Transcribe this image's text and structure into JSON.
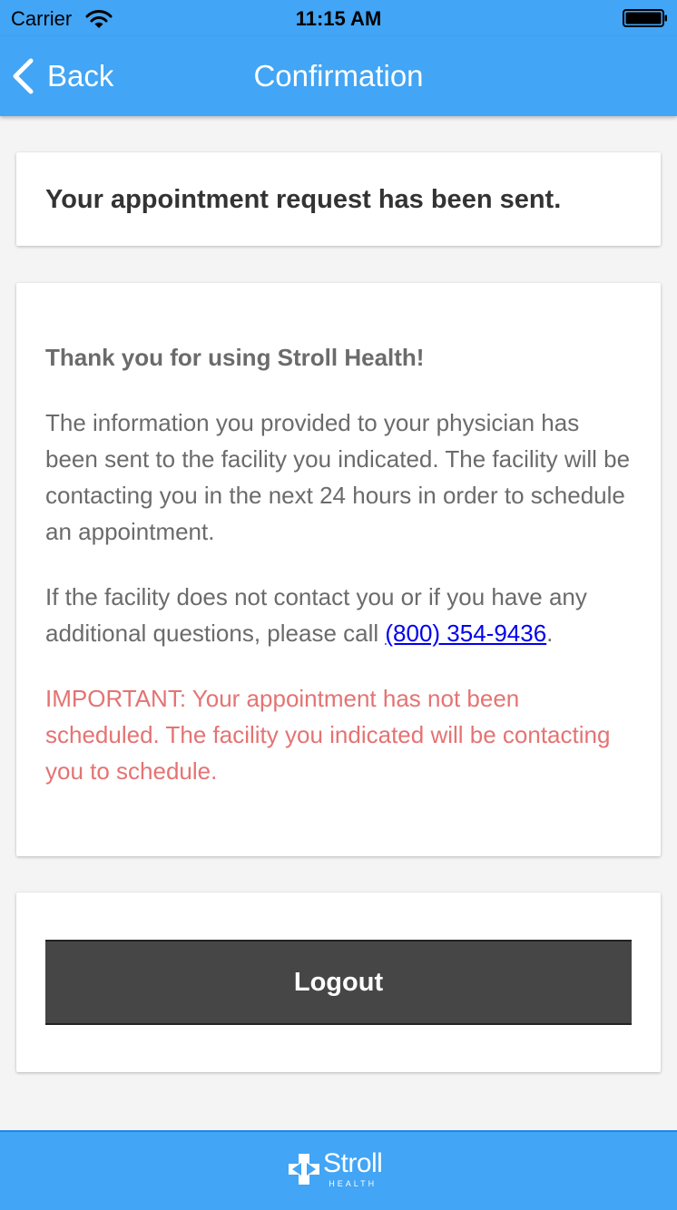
{
  "status_bar": {
    "carrier": "Carrier",
    "time": "11:15 AM",
    "wifi_icon": "wifi-icon",
    "battery_icon": "battery-icon"
  },
  "nav": {
    "back_label": "Back",
    "title": "Confirmation",
    "back_icon": "chevron-left-icon"
  },
  "header_card": {
    "text": "Your appointment request has been sent."
  },
  "message_card": {
    "heading": "Thank you for using Stroll Health!",
    "paragraph_1": "The information you provided to your physician has been sent to the facility you indicated. The facility will be contacting you in the next 24 hours in order to schedule an appointment.",
    "paragraph_2_before": "If the facility does not contact you or if you have any additional questions, please call ",
    "phone": "(800) 354-9436",
    "paragraph_2_after": ".",
    "important": "IMPORTANT: Your appointment has not been scheduled. The facility you indicated will be contacting you to schedule."
  },
  "actions": {
    "logout_label": "Logout"
  },
  "footer": {
    "brand": "Stroll",
    "sub": "HEALTH",
    "logo_icon": "cross-icon"
  },
  "colors": {
    "primary": "#42a5f5",
    "button": "#464646",
    "important": "#e57373",
    "link": "#0000ee",
    "background": "#f4f4f4"
  }
}
